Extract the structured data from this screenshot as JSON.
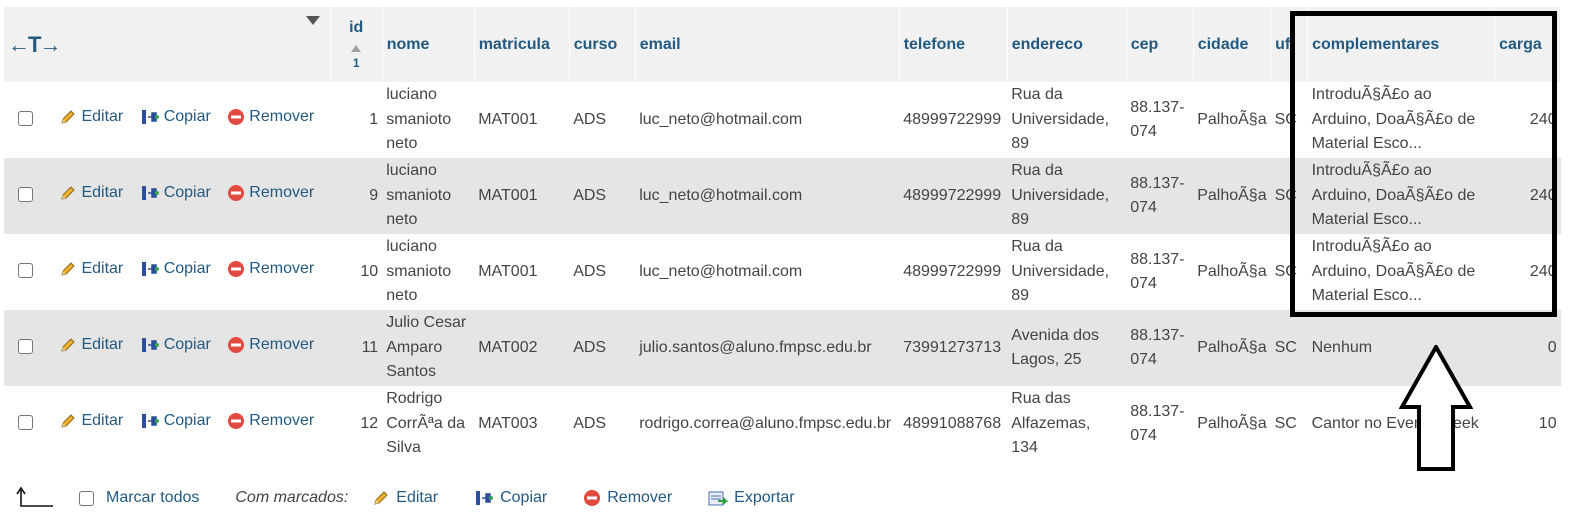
{
  "header": {
    "resize_glyph": "←T→",
    "columns": {
      "id": "id",
      "id_sort_index": "1",
      "nome": "nome",
      "matricula": "matricula",
      "curso": "curso",
      "email": "email",
      "telefone": "telefone",
      "endereco": "endereco",
      "cep": "cep",
      "cidade": "cidade",
      "uf": "uf",
      "complementares": "complementares",
      "carga": "carga"
    }
  },
  "actions": {
    "edit": "Editar",
    "copy": "Copiar",
    "remove": "Remover"
  },
  "rows": [
    {
      "id": "1",
      "nome": [
        "luciano",
        "smanioto",
        "neto"
      ],
      "matricula": "MAT001",
      "curso": "ADS",
      "email": "luc_neto@hotmail.com",
      "telefone": "48999722999",
      "endereco": [
        "Rua da",
        "Universidade,",
        "89"
      ],
      "cep": [
        "88.137-",
        "074"
      ],
      "cidade": "PalhoÃ§a",
      "uf": "SC",
      "complementares": [
        "IntroduÃ§Ã£o ao",
        "Arduino, DoaÃ§Ã£o de",
        "Material Esco..."
      ],
      "carga": "240"
    },
    {
      "id": "9",
      "nome": [
        "luciano",
        "smanioto",
        "neto"
      ],
      "matricula": "MAT001",
      "curso": "ADS",
      "email": "luc_neto@hotmail.com",
      "telefone": "48999722999",
      "endereco": [
        "Rua da",
        "Universidade,",
        "89"
      ],
      "cep": [
        "88.137-",
        "074"
      ],
      "cidade": "PalhoÃ§a",
      "uf": "SC",
      "complementares": [
        "IntroduÃ§Ã£o ao",
        "Arduino, DoaÃ§Ã£o de",
        "Material Esco..."
      ],
      "carga": "240"
    },
    {
      "id": "10",
      "nome": [
        "luciano",
        "smanioto",
        "neto"
      ],
      "matricula": "MAT001",
      "curso": "ADS",
      "email": "luc_neto@hotmail.com",
      "telefone": "48999722999",
      "endereco": [
        "Rua da",
        "Universidade,",
        "89"
      ],
      "cep": [
        "88.137-",
        "074"
      ],
      "cidade": "PalhoÃ§a",
      "uf": "SC",
      "complementares": [
        "IntroduÃ§Ã£o ao",
        "Arduino, DoaÃ§Ã£o de",
        "Material Esco..."
      ],
      "carga": "240"
    },
    {
      "id": "11",
      "nome": [
        "Julio Cesar",
        "Amparo",
        "Santos"
      ],
      "matricula": "MAT002",
      "curso": "ADS",
      "email": "julio.santos@aluno.fmpsc.edu.br",
      "telefone": "73991273713",
      "endereco": [
        "Avenida dos",
        "Lagos, 25"
      ],
      "cep": [
        "88.137-",
        "074"
      ],
      "cidade": "PalhoÃ§a",
      "uf": "SC",
      "complementares": [
        "Nenhum"
      ],
      "carga": "0"
    },
    {
      "id": "12",
      "nome": [
        "Rodrigo",
        "CorrÃªa da",
        "Silva"
      ],
      "matricula": "MAT003",
      "curso": "ADS",
      "email": "rodrigo.correa@aluno.fmpsc.edu.br",
      "telefone": "48991088768",
      "endereco": [
        "Rua das",
        "Alfazemas,",
        "134"
      ],
      "cep": [
        "88.137-",
        "074"
      ],
      "cidade": "PalhoÃ§a",
      "uf": "SC",
      "complementares": [
        "Cantor no Evento Geek"
      ],
      "carga": "10"
    }
  ],
  "footer": {
    "check_all": "Marcar todos",
    "with_selected": "Com marcados:",
    "edit": "Editar",
    "remove": "Remover",
    "export": "Exportar"
  },
  "colors": {
    "link": "#235a81",
    "even_row": "#e5e5e5",
    "header_bg": "#f1f1f1",
    "highlight": "#000000"
  }
}
